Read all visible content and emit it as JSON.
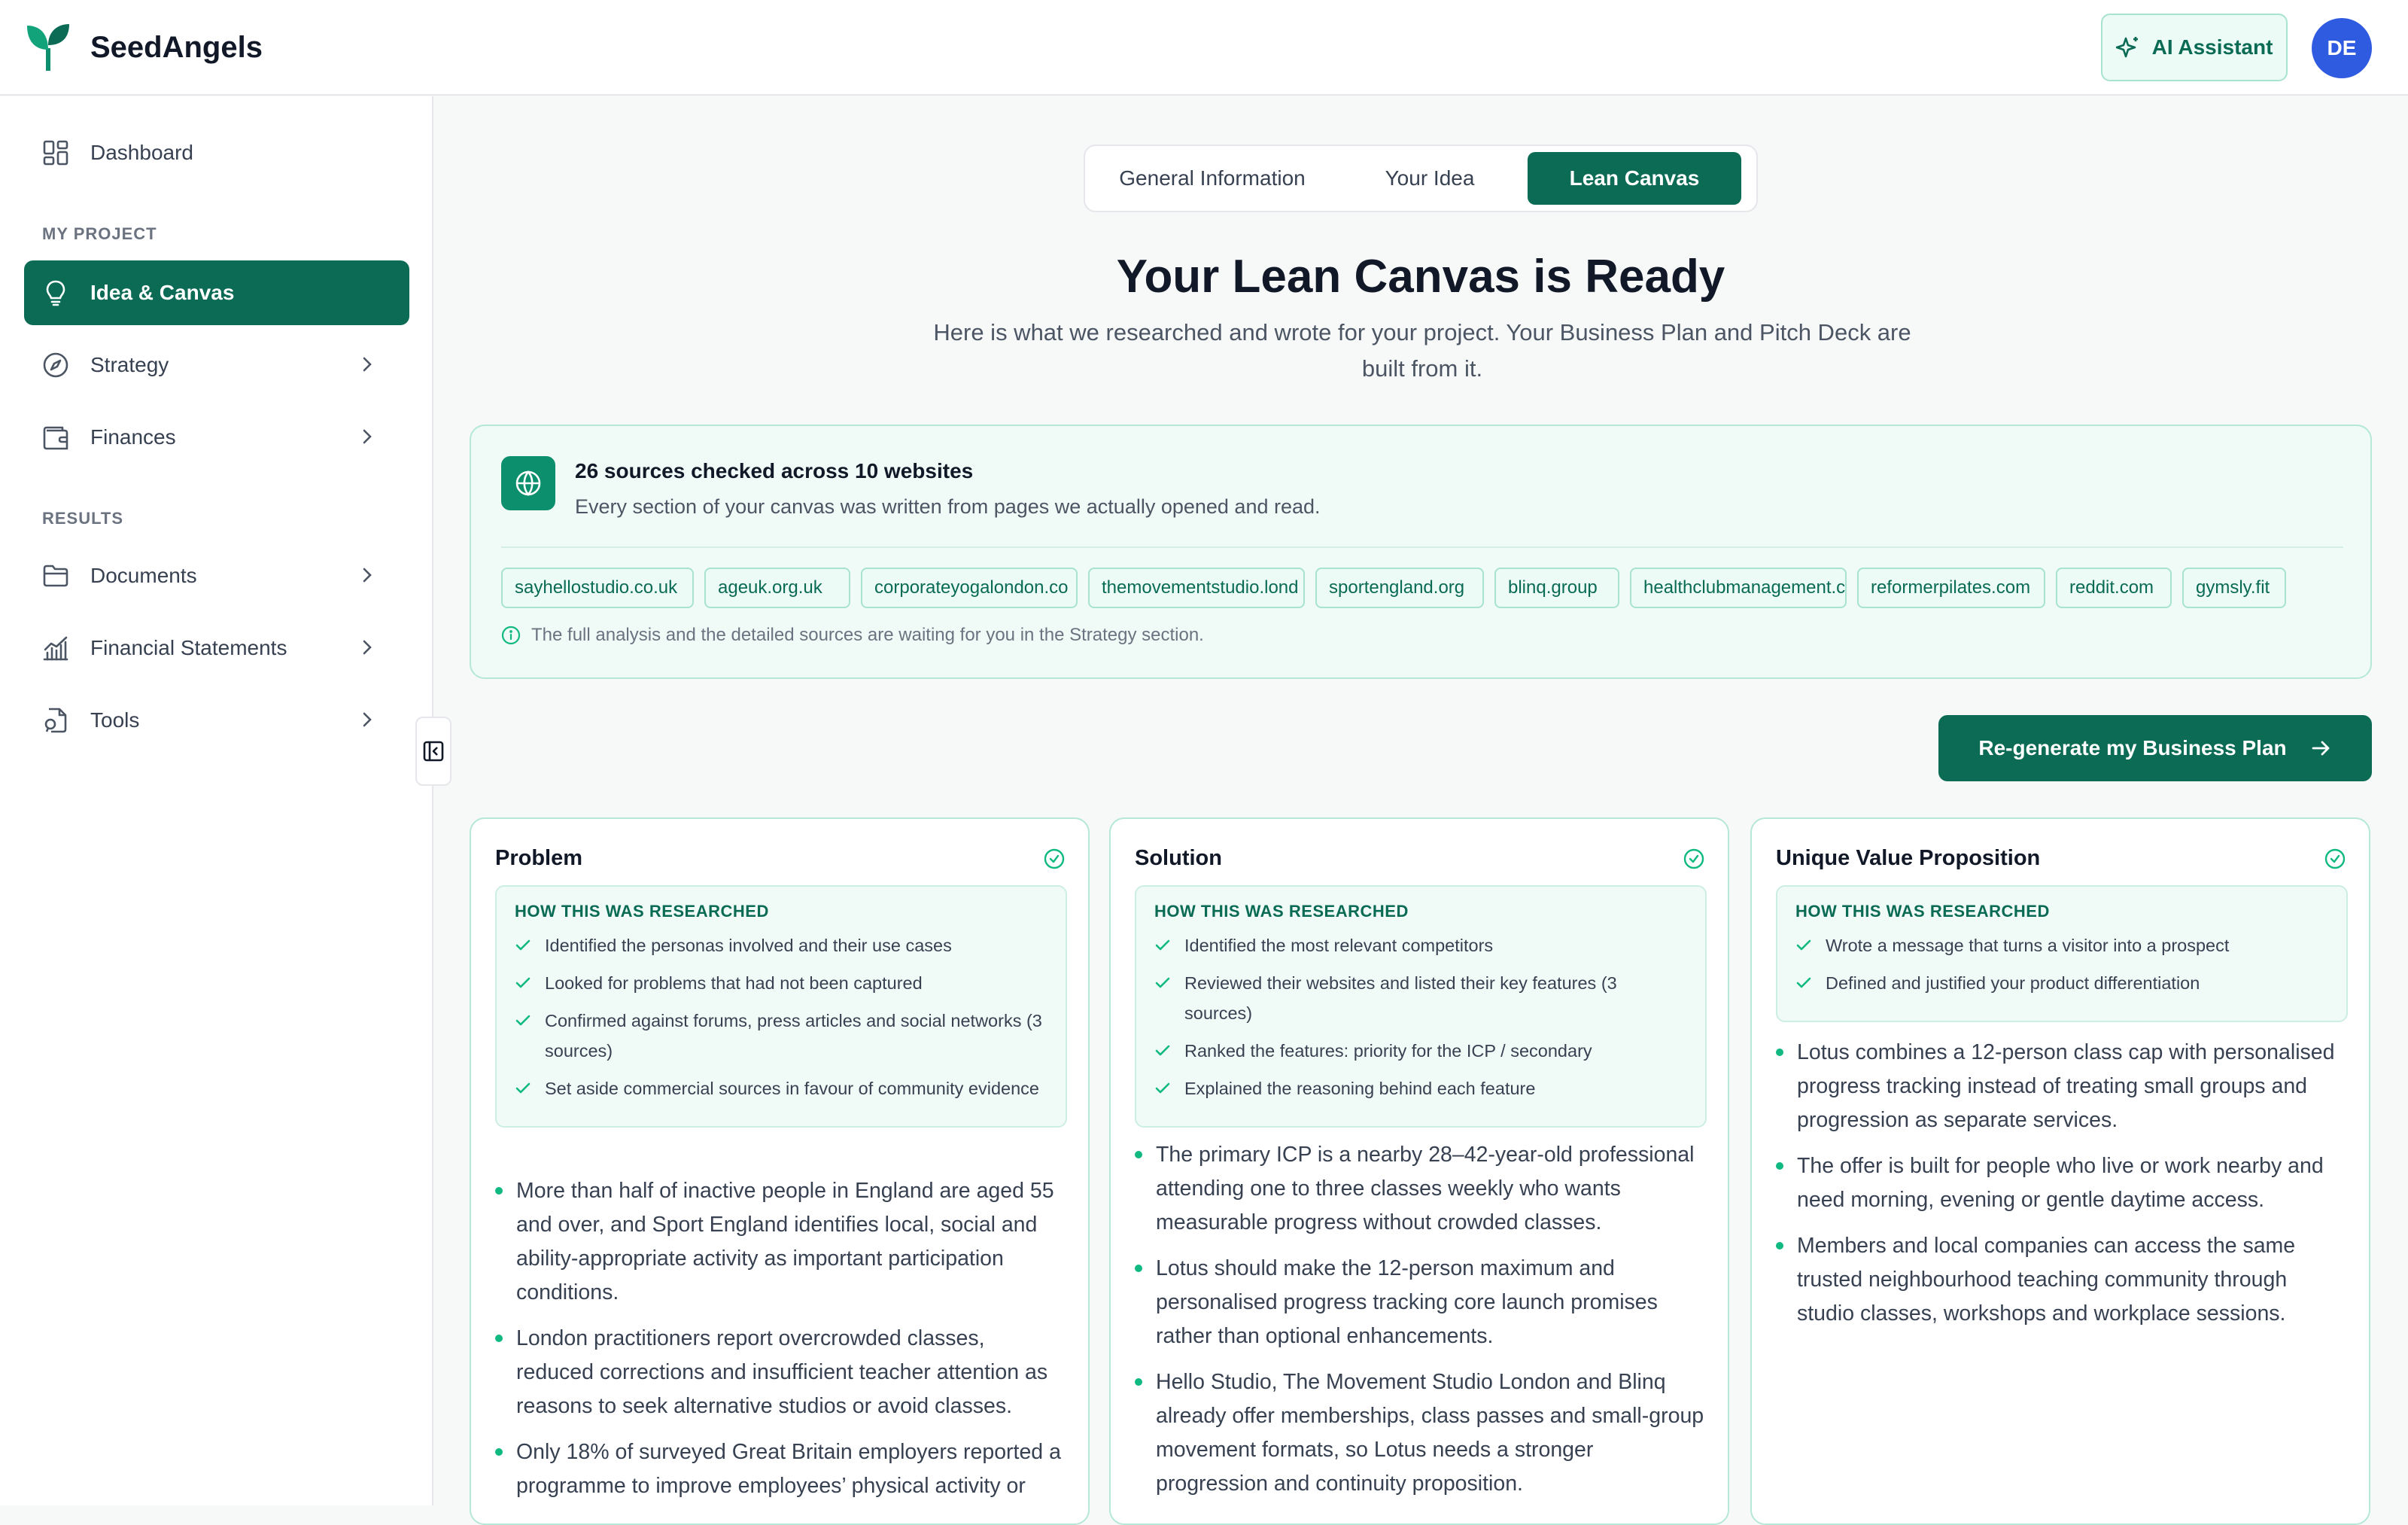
{
  "app": {
    "name": "SeedAngels"
  },
  "header": {
    "ai_assistant_label": "AI Assistant",
    "avatar_initials": "DE"
  },
  "sidebar": {
    "dashboard": "Dashboard",
    "my_project_label": "MY PROJECT",
    "idea_canvas": "Idea & Canvas",
    "strategy": "Strategy",
    "finances": "Finances",
    "results_label": "RESULTS",
    "documents": "Documents",
    "financial_statements": "Financial Statements",
    "tools": "Tools"
  },
  "tabs": [
    "General Information",
    "Your Idea",
    "Lean Canvas"
  ],
  "active_tab": "Lean Canvas",
  "hero": {
    "title": "Your Lean Canvas is Ready",
    "subtitle": "Here is what we researched and wrote for your project. Your Business Plan and Pitch Deck are built from it."
  },
  "sources": {
    "title": "26 sources checked across 10 websites",
    "subtitle": "Every section of your canvas was written from pages we actually opened and read.",
    "chips": [
      "sayhellostudio.co.uk",
      "ageuk.org.uk",
      "corporateyogalondon.co",
      "themovementstudio.lond",
      "sportengland.org",
      "blinq.group",
      "healthclubmanagement.c",
      "reformerpilates.com",
      "reddit.com",
      "gymsly.fit"
    ],
    "note": "The full analysis and the detailed sources are waiting for you in the Strategy section."
  },
  "regen_button": "Re-generate my Business Plan",
  "research_heading": "HOW THIS WAS RESEARCHED",
  "cards": [
    {
      "title": "Problem",
      "research": [
        "Identified the personas involved and their use cases",
        "Looked for problems that had not been captured",
        "Confirmed against forums, press articles and social networks (3 sources)",
        "Set aside commercial sources in favour of community evidence"
      ],
      "bullets": [
        "More than half of inactive people in England are aged 55 and over, and Sport England identifies local, social and ability-appropriate activity as important participation conditions.",
        "London practitioners report overcrowded classes, reduced corrections and insufficient teacher attention as reasons to seek alternative studios or avoid classes.",
        "Only 18% of surveyed Great Britain employers reported a programme to improve employees’ physical activity or"
      ]
    },
    {
      "title": "Solution",
      "research": [
        "Identified the most relevant competitors",
        "Reviewed their websites and listed their key features (3 sources)",
        "Ranked the features: priority for the ICP / secondary",
        "Explained the reasoning behind each feature"
      ],
      "bullets": [
        "The primary ICP is a nearby 28–42-year-old professional attending one to three classes weekly who wants measurable progress without crowded classes.",
        "Lotus should make the 12-person maximum and personalised progress tracking core launch promises rather than optional enhancements.",
        "Hello Studio, The Movement Studio London and Blinq already offer memberships, class passes and small-group movement formats, so Lotus needs a stronger progression and continuity proposition."
      ]
    },
    {
      "title": "Unique Value Proposition",
      "research": [
        "Wrote a message that turns a visitor into a prospect",
        "Defined and justified your product differentiation"
      ],
      "bullets": [
        "Lotus combines a 12-person class cap with personalised progress tracking instead of treating small groups and progression as separate services.",
        "The offer is built for people who live or work nearby and need morning, evening or gentle daytime access.",
        "Members and local companies can access the same trusted neighbourhood teaching community through studio classes, workshops and workplace sessions."
      ]
    }
  ],
  "colors": {
    "brand": "#0b6b55",
    "accent": "#10b981",
    "avatar": "#2f5be0"
  }
}
